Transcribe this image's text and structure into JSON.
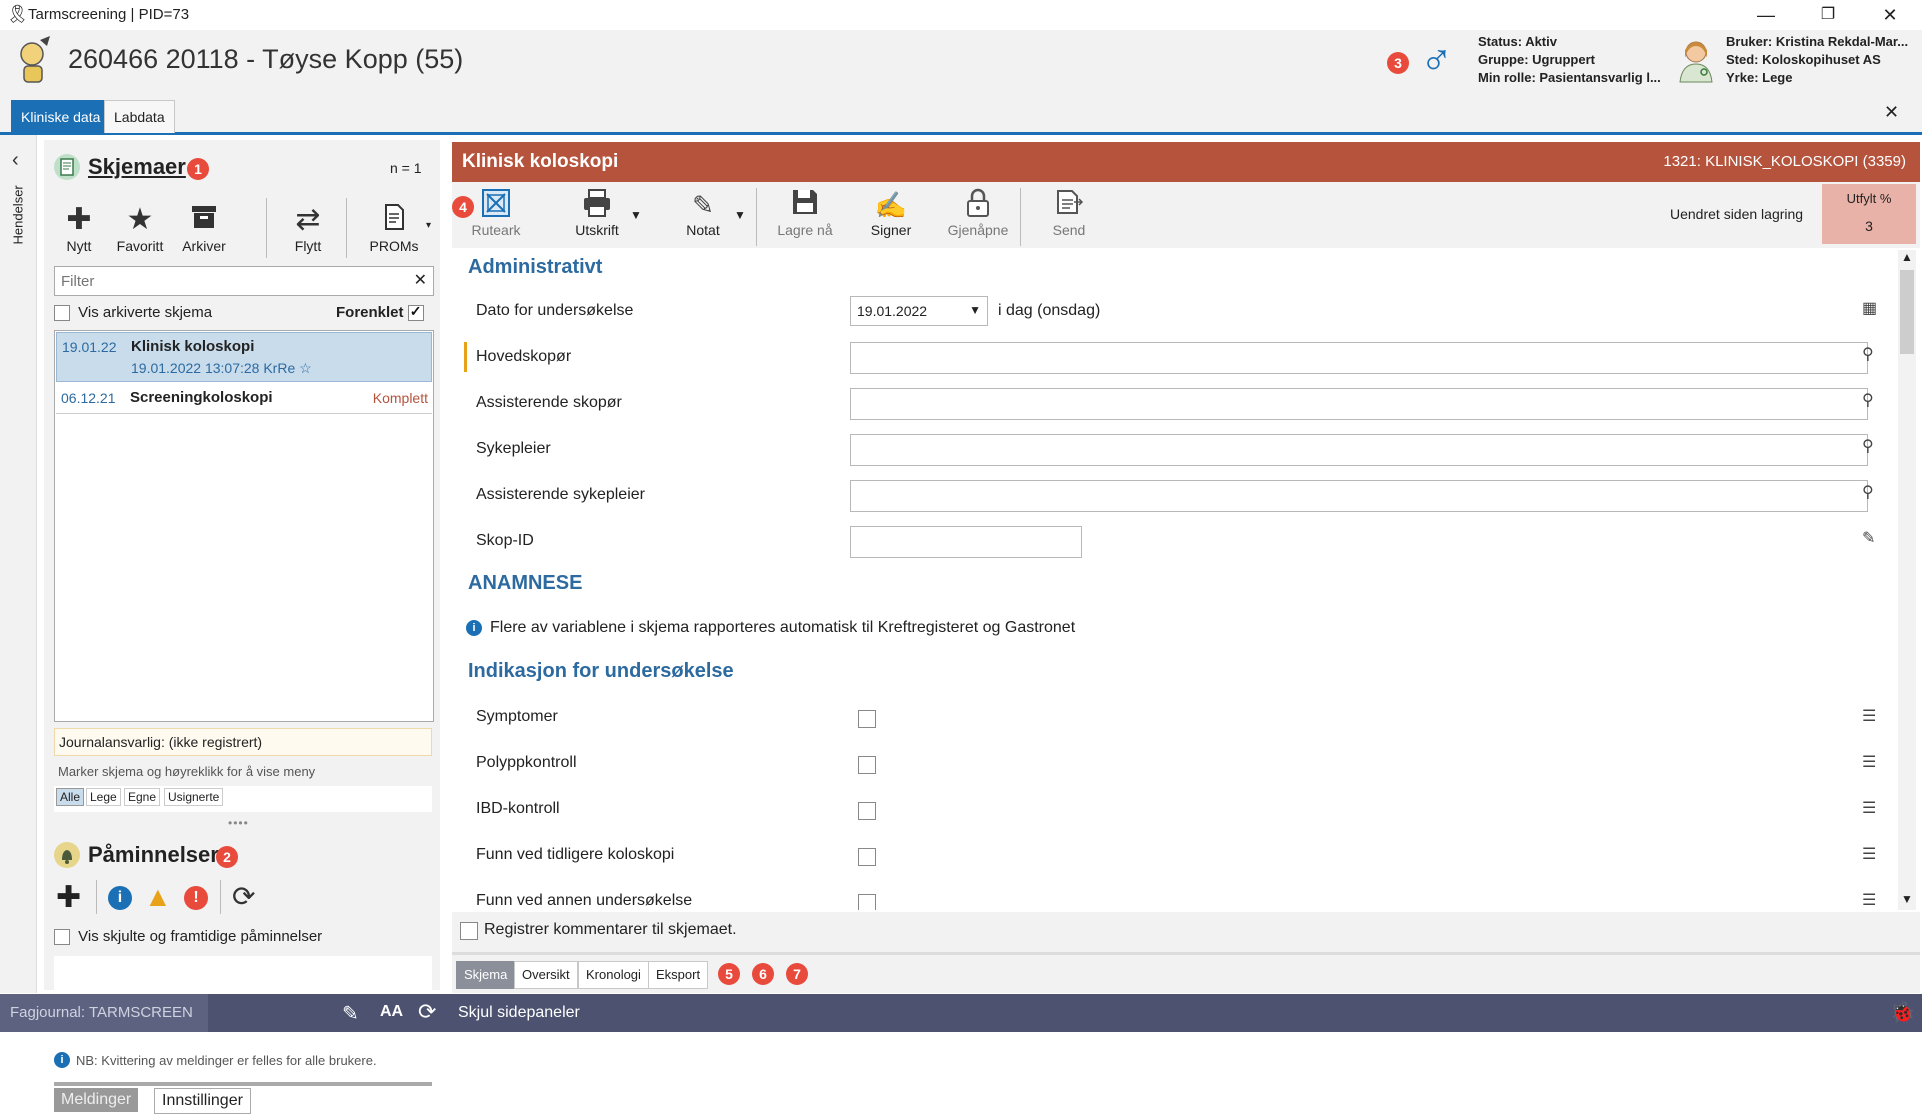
{
  "window": {
    "title": "Tarmscreening | PID=73",
    "minimize": "—",
    "restore": "❐",
    "close": "✕"
  },
  "header": {
    "patient": "260466 20118 - Tøyse Kopp (55)",
    "badge3": "3",
    "status": "Status: Aktiv",
    "group": "Gruppe: Ugruppert",
    "role": "Min rolle: Pasientansvarlig l...",
    "user": "Bruker: Kristina Rekdal-Mar...",
    "place": "Sted: Koloskopihuset AS",
    "profession": "Yrke: Lege",
    "male_symbol": "♂"
  },
  "toptabs": {
    "tab1": "Kliniske data",
    "tab2": "Labdata"
  },
  "sidestrip": {
    "label": "Hendelser"
  },
  "forms_panel": {
    "title": "Skjemaer",
    "badge": "1",
    "count": "n = 1",
    "toolbar": {
      "new": "Nytt",
      "favorite": "Favoritt",
      "archive": "Arkiver",
      "move": "Flytt",
      "proms": "PROMs"
    },
    "filter_placeholder": "Filter",
    "show_archived": "Vis arkiverte skjema",
    "simplified": "Forenklet",
    "items": [
      {
        "date": "19.01.22",
        "name": "Klinisk koloskopi",
        "sub": "19.01.2022 13:07:28 KrRe ☆",
        "status": ""
      },
      {
        "date": "06.12.21",
        "name": "Screeningkoloskopi",
        "sub": "",
        "status": "Komplett"
      }
    ],
    "journal_resp": "Journalansvarlig: (ikke registrert)",
    "hint": "Marker skjema og høyreklikk for å vise meny",
    "filters": [
      "Alle",
      "Lege",
      "Egne",
      "Usignerte"
    ]
  },
  "reminders_panel": {
    "title": "Påminnelser",
    "badge": "2",
    "show_hidden": "Vis skjulte og framtidige påminnelser",
    "note": "NB: Kvittering av meldinger er felles for alle brukere.",
    "tab_messages": "Meldinger",
    "tab_settings": "Innstillinger"
  },
  "main": {
    "title": "Klinisk koloskopi",
    "code": "1321: KLINISK_KOLOSKOPI (3359)",
    "toolbar": {
      "badge4": "4",
      "ruteark": "Ruteark",
      "print": "Utskrift",
      "note": "Notat",
      "save": "Lagre nå",
      "sign": "Signer",
      "reopen": "Gjenåpne",
      "send": "Send",
      "changed": "Uendret siden lagring",
      "filled_label": "Utfylt %",
      "filled_value": "3"
    },
    "sections": {
      "admin": "Administrativt",
      "anamnese": "ANAMNESE",
      "indication": "Indikasjon for undersøkelse"
    },
    "fields": {
      "date_label": "Dato for undersøkelse",
      "date_value": "19.01.2022",
      "date_note": "i dag (onsdag)",
      "main_scope": "Hovedskopør",
      "assist_scope": "Assisterende skopør",
      "nurse": "Sykepleier",
      "assist_nurse": "Assisterende sykepleier",
      "scope_id": "Skop-ID"
    },
    "info_text": "Flere av variablene i skjema rapporteres automatisk til Kreftregisteret og Gastronet",
    "indications": [
      "Symptomer",
      "Polyppkontroll",
      "IBD-kontroll",
      "Funn ved tidligere koloskopi",
      "Funn ved annen undersøkelse"
    ],
    "comment_label": "Registrer kommentarer til skjemaet.",
    "bottom_tabs": [
      "Skjema",
      "Oversikt",
      "Kronologi",
      "Eksport"
    ],
    "bottom_badges": [
      "5",
      "6",
      "7"
    ]
  },
  "statusbar": {
    "journal": "Fagjournal: TARMSCREEN",
    "font_label": "AA",
    "hide_panels": "Skjul sidepaneler"
  },
  "colors": {
    "accent_blue": "#1a6fb5",
    "header_rust": "#b5533c",
    "badge_red": "#e84a3c",
    "statusbar": "#4c5270",
    "filled_bg": "#e8b2a8"
  }
}
